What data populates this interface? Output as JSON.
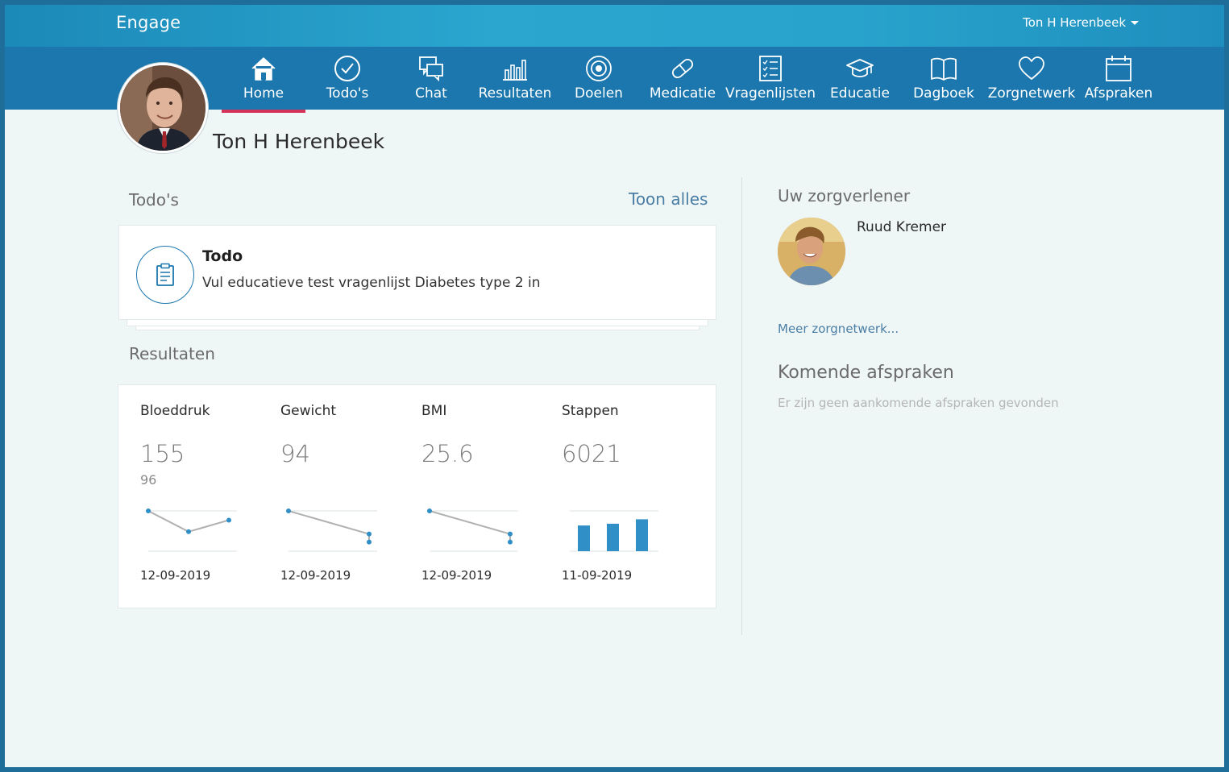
{
  "app": {
    "brand": "Engage",
    "user_menu_label": "Ton H Herenbeek"
  },
  "nav": {
    "items": [
      {
        "label": "Home",
        "icon": "home-icon",
        "active": true
      },
      {
        "label": "Todo's",
        "icon": "check-circle-icon"
      },
      {
        "label": "Chat",
        "icon": "chat-icon"
      },
      {
        "label": "Resultaten",
        "icon": "bar-chart-icon"
      },
      {
        "label": "Doelen",
        "icon": "target-icon"
      },
      {
        "label": "Medicatie",
        "icon": "pill-icon"
      },
      {
        "label": "Vragenlijsten",
        "icon": "checklist-icon"
      },
      {
        "label": "Educatie",
        "icon": "graduation-cap-icon"
      },
      {
        "label": "Dagboek",
        "icon": "book-icon"
      },
      {
        "label": "Zorgnetwerk",
        "icon": "heart-icon"
      },
      {
        "label": "Afspraken",
        "icon": "calendar-icon"
      }
    ]
  },
  "profile": {
    "name": "Ton H Herenbeek"
  },
  "todos": {
    "title": "Todo's",
    "show_all": "Toon alles",
    "item": {
      "title": "Todo",
      "description": "Vul educatieve test vragenlijst Diabetes type 2 in",
      "icon": "clipboard-icon"
    }
  },
  "results": {
    "title": "Resultaten",
    "metrics": [
      {
        "label": "Bloeddruk",
        "value": "155",
        "sub": "96",
        "date": "12-09-2019",
        "chart": "line",
        "points": [
          3,
          1.2,
          2.2
        ]
      },
      {
        "label": "Gewicht",
        "value": "94",
        "sub": "",
        "date": "12-09-2019",
        "chart": "line",
        "points": [
          3,
          1.0
        ]
      },
      {
        "label": "BMI",
        "value": "25.6",
        "sub": "",
        "date": "12-09-2019",
        "chart": "line",
        "points": [
          3,
          1.0
        ]
      },
      {
        "label": "Stappen",
        "value": "6021",
        "sub": "",
        "date": "11-09-2019",
        "chart": "bar",
        "points": [
          0.58,
          0.62,
          0.72
        ]
      }
    ]
  },
  "provider": {
    "title": "Uw zorgverlener",
    "name": "Ruud Kremer",
    "more_link": "Meer zorgnetwerk..."
  },
  "appointments": {
    "title": "Komende afspraken",
    "empty_text": "Er zijn geen aankomende afspraken gevonden"
  },
  "colors": {
    "accent": "#1b77ad",
    "active_underline": "#d6335a",
    "chart_point": "#2f8fc6",
    "chart_line": "#b0b0b0"
  }
}
